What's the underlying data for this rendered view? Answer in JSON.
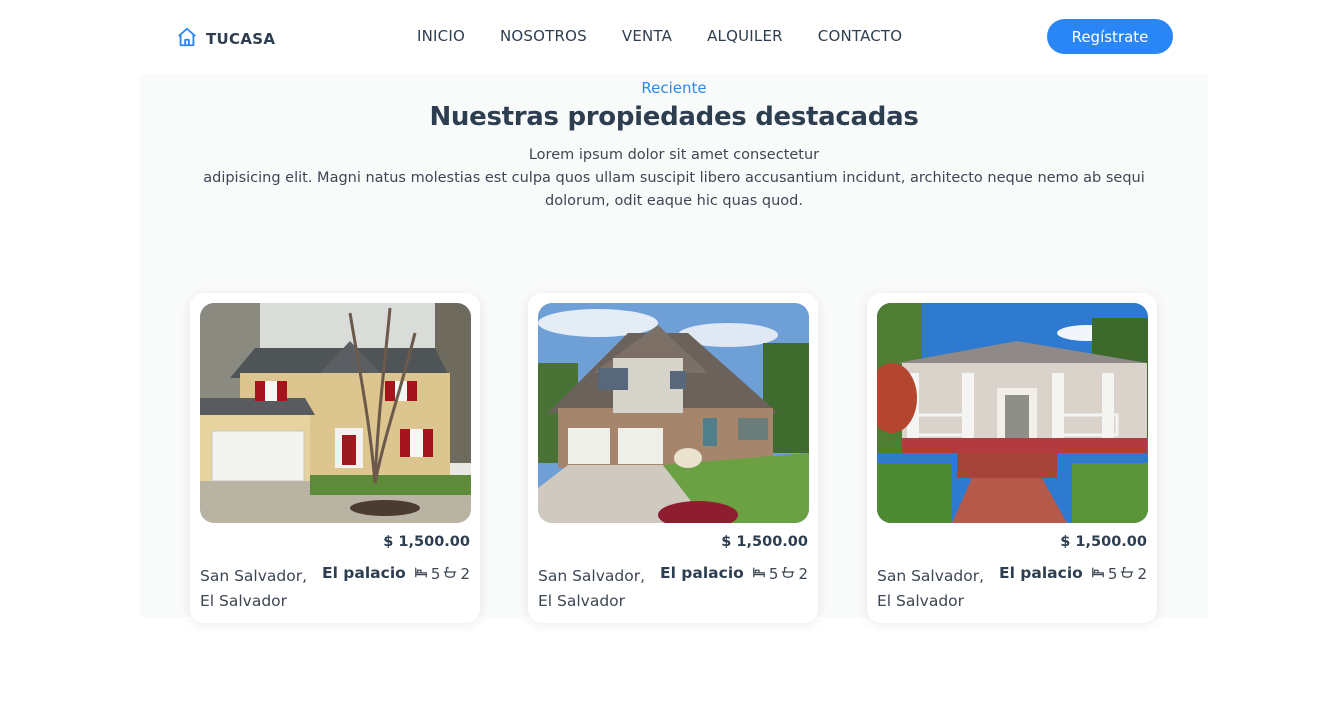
{
  "brand": {
    "name": "TUCASA",
    "icon": "home-icon",
    "accent": "#2b86f5"
  },
  "nav": {
    "items": [
      "INICIO",
      "NOSOTROS",
      "VENTA",
      "ALQUILER",
      "CONTACTO"
    ],
    "register_label": "Regístrate"
  },
  "featured": {
    "eyebrow": "Reciente",
    "title": "Nuestras propiedades destacadas",
    "description_line1": "Lorem ipsum dolor sit amet consectetur",
    "description_rest": "adipisicing elit. Magni natus molestias est culpa quos ullam suscipit libero accusantium incidunt, architecto neque nemo ab sequi dolorum, odit eaque hic quas quod."
  },
  "properties": [
    {
      "price": "$ 1,500.00",
      "location": "San Salvador, El Salvador",
      "name": "El palacio",
      "beds": "5",
      "baths": "2",
      "image": "two-story-yellow-house-photo"
    },
    {
      "price": "$ 1,500.00",
      "location": "San Salvador, El Salvador",
      "name": "El palacio",
      "beds": "5",
      "baths": "2",
      "image": "stone-craftsman-house-photo"
    },
    {
      "price": "$ 1,500.00",
      "location": "San Salvador, El Salvador",
      "name": "El palacio",
      "beds": "5",
      "baths": "2",
      "image": "bungalow-porch-house-photo"
    }
  ]
}
